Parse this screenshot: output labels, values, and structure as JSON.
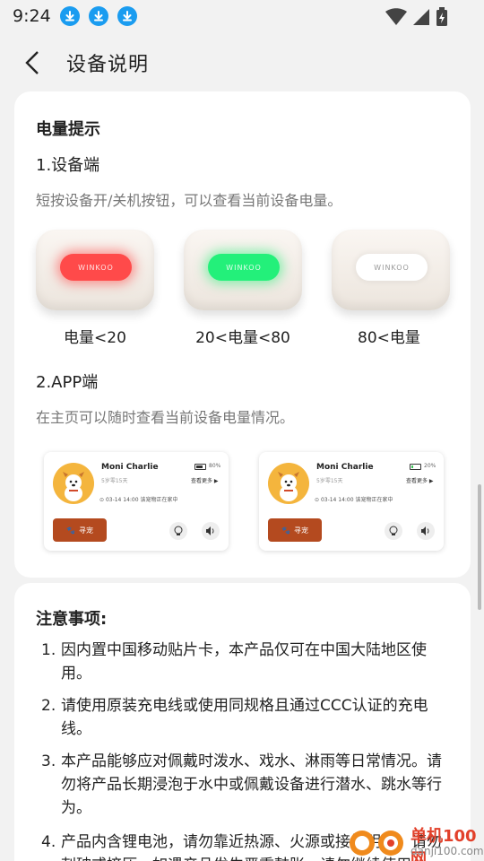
{
  "status": {
    "time": "9:24"
  },
  "header": {
    "title": "设备说明"
  },
  "battery_section": {
    "title": "电量提示",
    "device_subtitle": "1.设备端",
    "device_desc": "短按设备开/关机按钮，可以查看当前设备电量。",
    "device_brand": "WINKOO",
    "levels": [
      {
        "label": "电量<20",
        "led_color": "#ff4a4a"
      },
      {
        "label": "20<电量<80",
        "led_color": "#23f07a"
      },
      {
        "label": "80<电量",
        "led_color": "#ffffff"
      }
    ],
    "app_subtitle": "2.APP端",
    "app_desc": "在主页可以随时查看当前设备电量情况。",
    "app_cards": [
      {
        "pet_name": "Moni Charlie",
        "pet_age": "5岁零15天",
        "battery_pct": "80%",
        "battery_level": 0.8,
        "battery_color": "#333333",
        "more": "查看更多 ▶",
        "location": "03-14  14:00  该宠物正在家中",
        "find_label": "寻宠"
      },
      {
        "pet_name": "Moni Charlie",
        "pet_age": "5岁零15天",
        "battery_pct": "20%",
        "battery_level": 0.2,
        "battery_color": "#3ec65a",
        "more": "查看更多 ▶",
        "location": "03-14  14:00  该宠物正在家中",
        "find_label": "寻宠"
      }
    ]
  },
  "notes_section": {
    "title": "注意事项:",
    "items": [
      {
        "num": "1.",
        "text": "因内置中国移动贴片卡，本产品仅可在中国大陆地区使用。"
      },
      {
        "num": "2.",
        "text": "请使用原装充电线或使用同规格且通过CCC认证的充电线。"
      },
      {
        "num": "3.",
        "text": "本产品能够应对佩戴时泼水、戏水、淋雨等日常情况。请勿将产品长期浸泡于水中或佩戴设备进行潜水、跳水等行为。"
      },
      {
        "num": "4.",
        "text": "产品内含锂电池，请勿靠近热源、火源或接触明火，请勿刺破或挤压，如遇产品发生严重鼓胀，请勿继续使用。"
      }
    ]
  },
  "watermark": {
    "site": "单机100网",
    "url": "danji100.com"
  }
}
